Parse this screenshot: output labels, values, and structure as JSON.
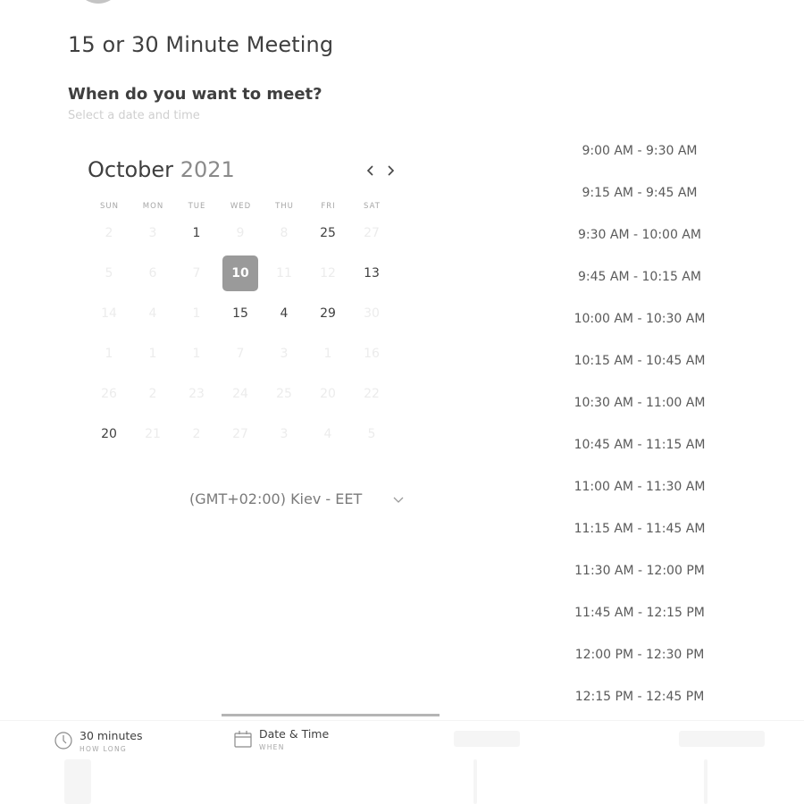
{
  "header": {
    "title": "15 or 30 Minute Meeting",
    "heading": "When do you want to meet?",
    "subheading": "Select a date and time"
  },
  "calendar": {
    "month": "October",
    "year": "2021",
    "prev_icon": "chevron-left-icon",
    "next_icon": "chevron-right-icon",
    "weekdays": [
      "SUN",
      "MON",
      "TUE",
      "WED",
      "THU",
      "FRI",
      "SAT"
    ],
    "days": {
      "r1_tue": "1",
      "r1_fri": "25",
      "r2_wed": "10",
      "r2_sat": "13",
      "r3_wed": "15",
      "r3_thu": "4",
      "r3_fri": "29",
      "r6_sun": "20"
    },
    "faded_days": {
      "r1_sun": "2",
      "r1_mon": "3",
      "r1_wed": "9",
      "r1_thu": "8",
      "r1_sat": "27",
      "r2_sun": "5",
      "r2_mon": "6",
      "r2_tue": "7",
      "r2_thu": "11",
      "r2_fri": "12",
      "r3_sun": "14",
      "r3_mon": "4",
      "r3_tue": "1",
      "r3_sat": "30",
      "r4_sun": "1",
      "r4_mon": "1",
      "r4_tue": "1",
      "r4_wed": "7",
      "r4_thu": "3",
      "r4_fri": "1",
      "r4_sat": "16",
      "r5_sun": "26",
      "r5_mon": "2",
      "r5_tue": "23",
      "r5_wed": "24",
      "r5_thu": "25",
      "r5_fri": "20",
      "r5_sat": "22",
      "r6_mon": "21",
      "r6_tue": "2",
      "r6_wed": "27",
      "r6_thu": "3",
      "r6_fri": "4",
      "r6_sat": "5"
    },
    "selected_date": "10",
    "timezone": "(GMT+02:00) Kiev - EET",
    "timezone_icon": "chevron-down-icon"
  },
  "time_slots": [
    "9:00 AM - 9:30 AM",
    "9:15 AM - 9:45 AM",
    "9:30 AM - 10:00 AM",
    "9:45 AM - 10:15 AM",
    "10:00 AM - 10:30 AM",
    "10:15 AM - 10:45 AM",
    "10:30 AM - 11:00 AM",
    "10:45 AM - 11:15 AM",
    "11:00 AM - 11:30 AM",
    "11:15 AM - 11:45 AM",
    "11:30 AM - 12:00 PM",
    "11:45 AM - 12:15 PM",
    "12:00 PM - 12:30 PM",
    "12:15 PM - 12:45 PM"
  ],
  "footer": {
    "steps": [
      {
        "label": "30 minutes",
        "sublabel": "HOW LONG",
        "icon": "clock-icon"
      },
      {
        "label": "Date & Time",
        "sublabel": "WHEN",
        "icon": "calendar-icon"
      }
    ]
  },
  "colors": {
    "selected_day": "#9a9a9a",
    "text": "#3f3f3f",
    "muted": "#a6a6a6",
    "faded": "#ececec",
    "active_step_bar": "#b5b5b5"
  }
}
